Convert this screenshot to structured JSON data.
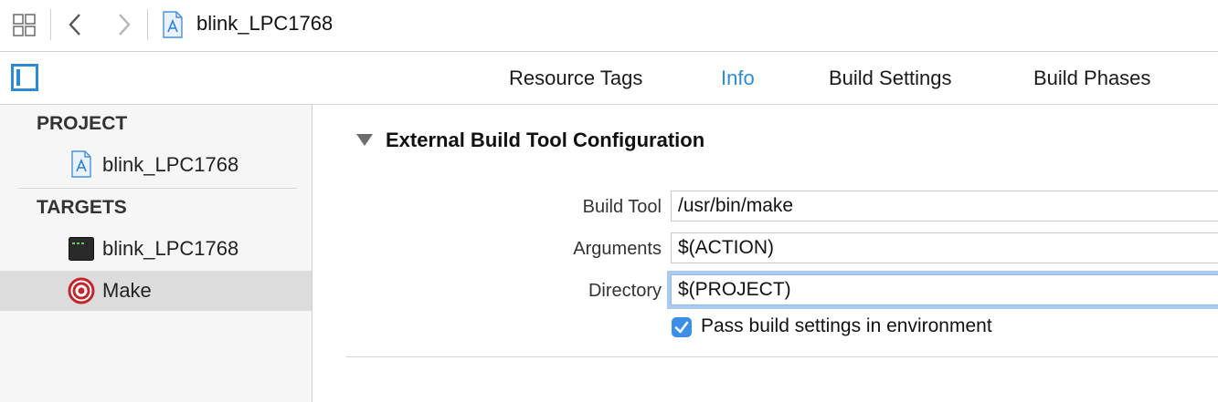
{
  "topbar": {
    "breadcrumb": "blink_LPC1768"
  },
  "tabs": [
    {
      "label": "Resource Tags",
      "active": false
    },
    {
      "label": "Info",
      "active": true
    },
    {
      "label": "Build Settings",
      "active": false
    },
    {
      "label": "Build Phases",
      "active": false
    }
  ],
  "sidebar": {
    "project_header": "PROJECT",
    "project_item": "blink_LPC1768",
    "targets_header": "TARGETS",
    "target_items": [
      {
        "label": "blink_LPC1768",
        "icon": "terminal-icon",
        "selected": false
      },
      {
        "label": "Make",
        "icon": "target-icon",
        "selected": true
      }
    ]
  },
  "main": {
    "section_title": "External Build Tool Configuration",
    "fields": [
      {
        "label": "Build Tool",
        "value": "/usr/bin/make"
      },
      {
        "label": "Arguments",
        "value": "$(ACTION)"
      },
      {
        "label": "Directory",
        "value": "$(PROJECT)"
      }
    ],
    "pass_env_label": "Pass build settings in environment",
    "pass_env_checked": true
  },
  "colors": {
    "accent": "#2f8ad4",
    "checkbox": "#3b8fe6",
    "focus_ring": "#a9cbf0",
    "selected_row": "#dcdcdc"
  }
}
